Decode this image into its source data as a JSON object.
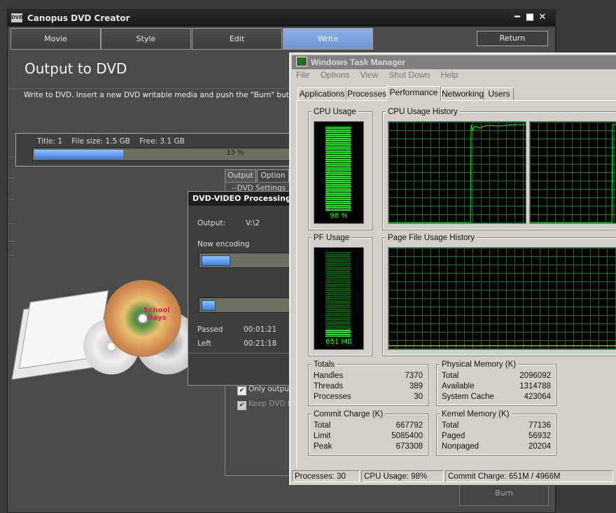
{
  "canopus": {
    "title": "Canopus DVD Creator",
    "logo_text": "DVD",
    "tabs": [
      {
        "label": "Movie"
      },
      {
        "label": "Style"
      },
      {
        "label": "Edit"
      },
      {
        "label": "Write"
      }
    ],
    "return_label": "Return",
    "heading": "Output to DVD",
    "instruction": "Write to DVD. Insert a new DVD writable media and push the \"Burn\" button.",
    "file_info": "Title: 1    File size: 1.5 GB    Free: 3.1 GB",
    "progress_percent": 33,
    "progress_label": "33 %",
    "option_tabs": [
      {
        "label": "Output"
      },
      {
        "label": "Option"
      }
    ],
    "dvd_settings_label": "DVD Settings",
    "checkbox_only_output": "Only output",
    "checkbox_keep_dvd": "Keep DVD fi",
    "burn_label": "Burn",
    "disc_label": "School Days"
  },
  "processing": {
    "title": "DVD-VIDEO Processing",
    "output_label": "Output:",
    "output_value": "V:\\2",
    "now_encoding": "Now encoding",
    "bar1_fraction": 0.3,
    "bar2_fraction": 0.14,
    "passed_label": "Passed",
    "passed_value": "00:01:21",
    "left_label": "Left",
    "left_value": "00:21:18"
  },
  "taskmanager": {
    "title": "Windows Task Manager",
    "menu": [
      "File",
      "Options",
      "View",
      "Shut Down",
      "Help"
    ],
    "tabs": [
      "Applications",
      "Processes",
      "Performance",
      "Networking",
      "Users"
    ],
    "active_tab": "Performance",
    "cpu_usage_label": "CPU Usage",
    "cpu_usage_value": "98 %",
    "cpu_usage_fraction": 0.98,
    "cpu_history_label": "CPU Usage History",
    "pf_usage_label": "PF Usage",
    "pf_usage_value": "651 MB",
    "pf_usage_fraction": 0.08,
    "pf_history_label": "Page File Usage History",
    "totals": {
      "label": "Totals",
      "rows": [
        {
          "key": "Handles",
          "value": "7370"
        },
        {
          "key": "Threads",
          "value": "389"
        },
        {
          "key": "Processes",
          "value": "30"
        }
      ]
    },
    "physical": {
      "label": "Physical Memory (K)",
      "rows": [
        {
          "key": "Total",
          "value": "2096092"
        },
        {
          "key": "Available",
          "value": "1314788"
        },
        {
          "key": "System Cache",
          "value": "423064"
        }
      ]
    },
    "commit": {
      "label": "Commit Charge (K)",
      "rows": [
        {
          "key": "Total",
          "value": "667792"
        },
        {
          "key": "Limit",
          "value": "5085400"
        },
        {
          "key": "Peak",
          "value": "673308"
        }
      ]
    },
    "kernel": {
      "label": "Kernel Memory (K)",
      "rows": [
        {
          "key": "Total",
          "value": "77136"
        },
        {
          "key": "Paged",
          "value": "56932"
        },
        {
          "key": "Nonpaged",
          "value": "20204"
        }
      ]
    },
    "status": {
      "processes": "Processes: 30",
      "cpu": "CPU Usage: 98%",
      "commit": "Commit Charge: 651M / 4966M"
    }
  }
}
